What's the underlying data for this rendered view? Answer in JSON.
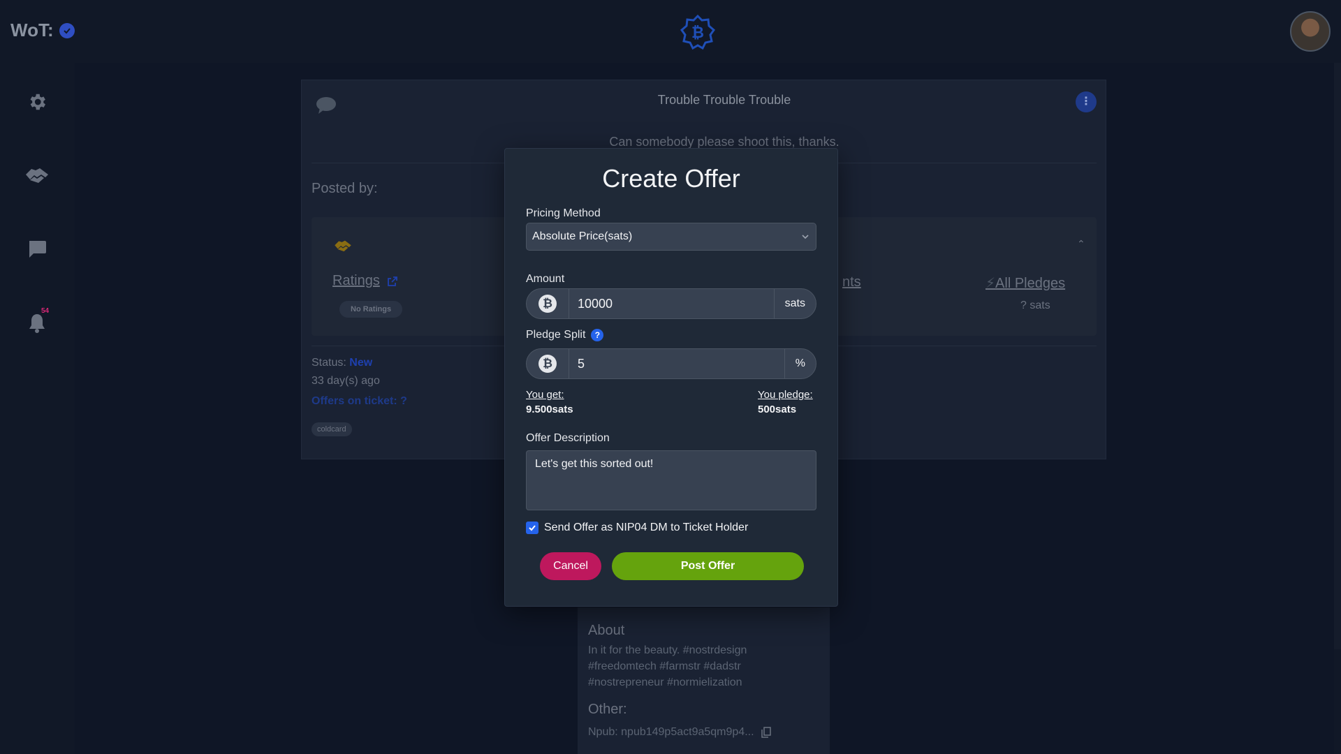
{
  "header": {
    "wot_label": "WoT:"
  },
  "sidebar": {
    "notification_count": "54"
  },
  "ticket": {
    "title": "Trouble Trouble Trouble",
    "description": "Can somebody please shoot this, thanks.",
    "menu_icon": "⋮",
    "posted_by_label": "Posted by:",
    "ratings_label": "Ratings",
    "no_ratings_label": "No Ratings",
    "comments_partial": "nts",
    "all_pledges_label": "All Pledges",
    "pledge_sats": "? sats",
    "status_label": "Status:",
    "status_value": "New",
    "age": "33 day(s) ago",
    "offers_label": "Offers on ticket: ?",
    "tag": "coldcard"
  },
  "profile": {
    "about_heading": "About",
    "about_text": "In it for the beauty. #nostrdesign #freedomtech #farmstr #dadstr #nostrepreneur #normielization",
    "other_heading": "Other:",
    "npub": "Npub: npub149p5act9a5qm9p4..."
  },
  "modal": {
    "title": "Create Offer",
    "pricing_label": "Pricing Method",
    "pricing_value": "Absolute Price(sats)",
    "amount_label": "Amount",
    "amount_value": "10000",
    "amount_unit": "sats",
    "split_label": "Pledge Split",
    "split_help": "?",
    "split_value": "5",
    "split_unit": "%",
    "btc_symbol": "₿",
    "you_get_label": "You get:",
    "you_get_value": "9.500sats",
    "you_pledge_label": "You pledge:",
    "you_pledge_value": "500sats",
    "description_label": "Offer Description",
    "description_value": "Let's get this sorted out!",
    "dm_label": "Send Offer as NIP04 DM to Ticket Holder",
    "dm_checked": true,
    "cancel_label": "Cancel",
    "post_label": "Post Offer"
  }
}
